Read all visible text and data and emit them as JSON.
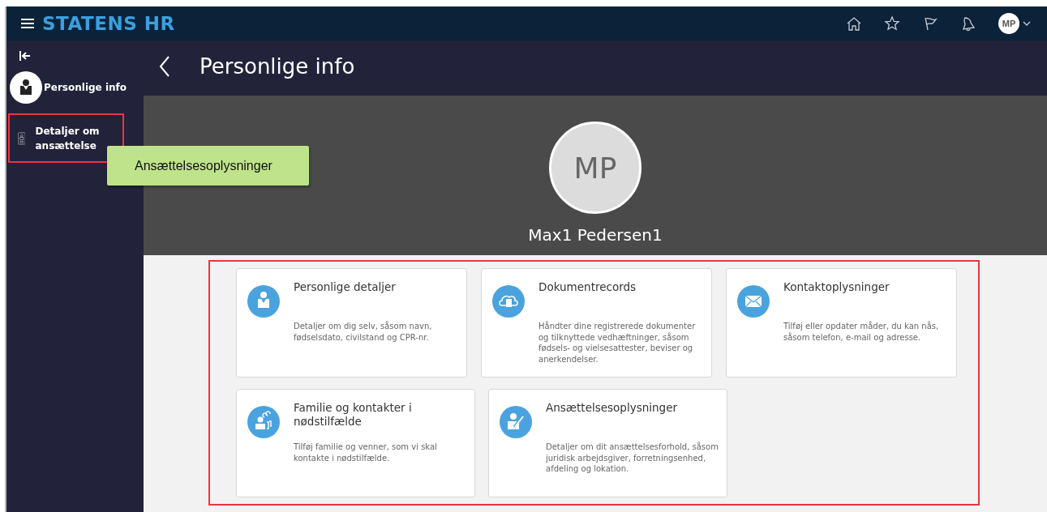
{
  "header": {
    "brand": "STATENS HR",
    "avatar": "MP"
  },
  "sidebar": {
    "items": [
      {
        "label": "Personlige info",
        "kind": "avatar",
        "highlighted": false
      },
      {
        "label": "Detaljer om ansættelse",
        "kind": "badge",
        "highlighted": true
      }
    ]
  },
  "tooltip": {
    "text": "Ansættelsesoplysninger"
  },
  "page": {
    "title": "Personlige info"
  },
  "profile": {
    "initials": "MP",
    "name": "Max1 Pedersen1"
  },
  "cards": {
    "highlighted": true,
    "rows": [
      [
        {
          "kind": "person",
          "title": "Personlige detaljer",
          "description": "Detaljer om dig selv, såsom navn, fødselsdato, civilstand og CPR-nr."
        },
        {
          "kind": "cloud",
          "title": "Dokumentrecords",
          "description": "Håndter dine registrerede dokumenter og tilknyttede vedhæftninger, såsom fødsels- og vielsesattester, beviser og anerkendelser."
        },
        {
          "kind": "mail",
          "title": "Kontaktoplysninger",
          "description": "Tilføj eller opdater måder, du kan nås, såsom telefon, e-mail og adresse."
        }
      ],
      [
        {
          "kind": "family",
          "title": "Familie og kontakter i nødstilfælde",
          "description": "Tilføj familie og venner, som vi skal kontakte i nødstilfælde."
        },
        {
          "kind": "employment",
          "title": "Ansættelsesoplysninger",
          "description": "Detaljer om dit ansættelsesforhold, såsom juridisk arbejdsgiver, forretningsenhed, afdeling og lokation."
        }
      ]
    ]
  }
}
